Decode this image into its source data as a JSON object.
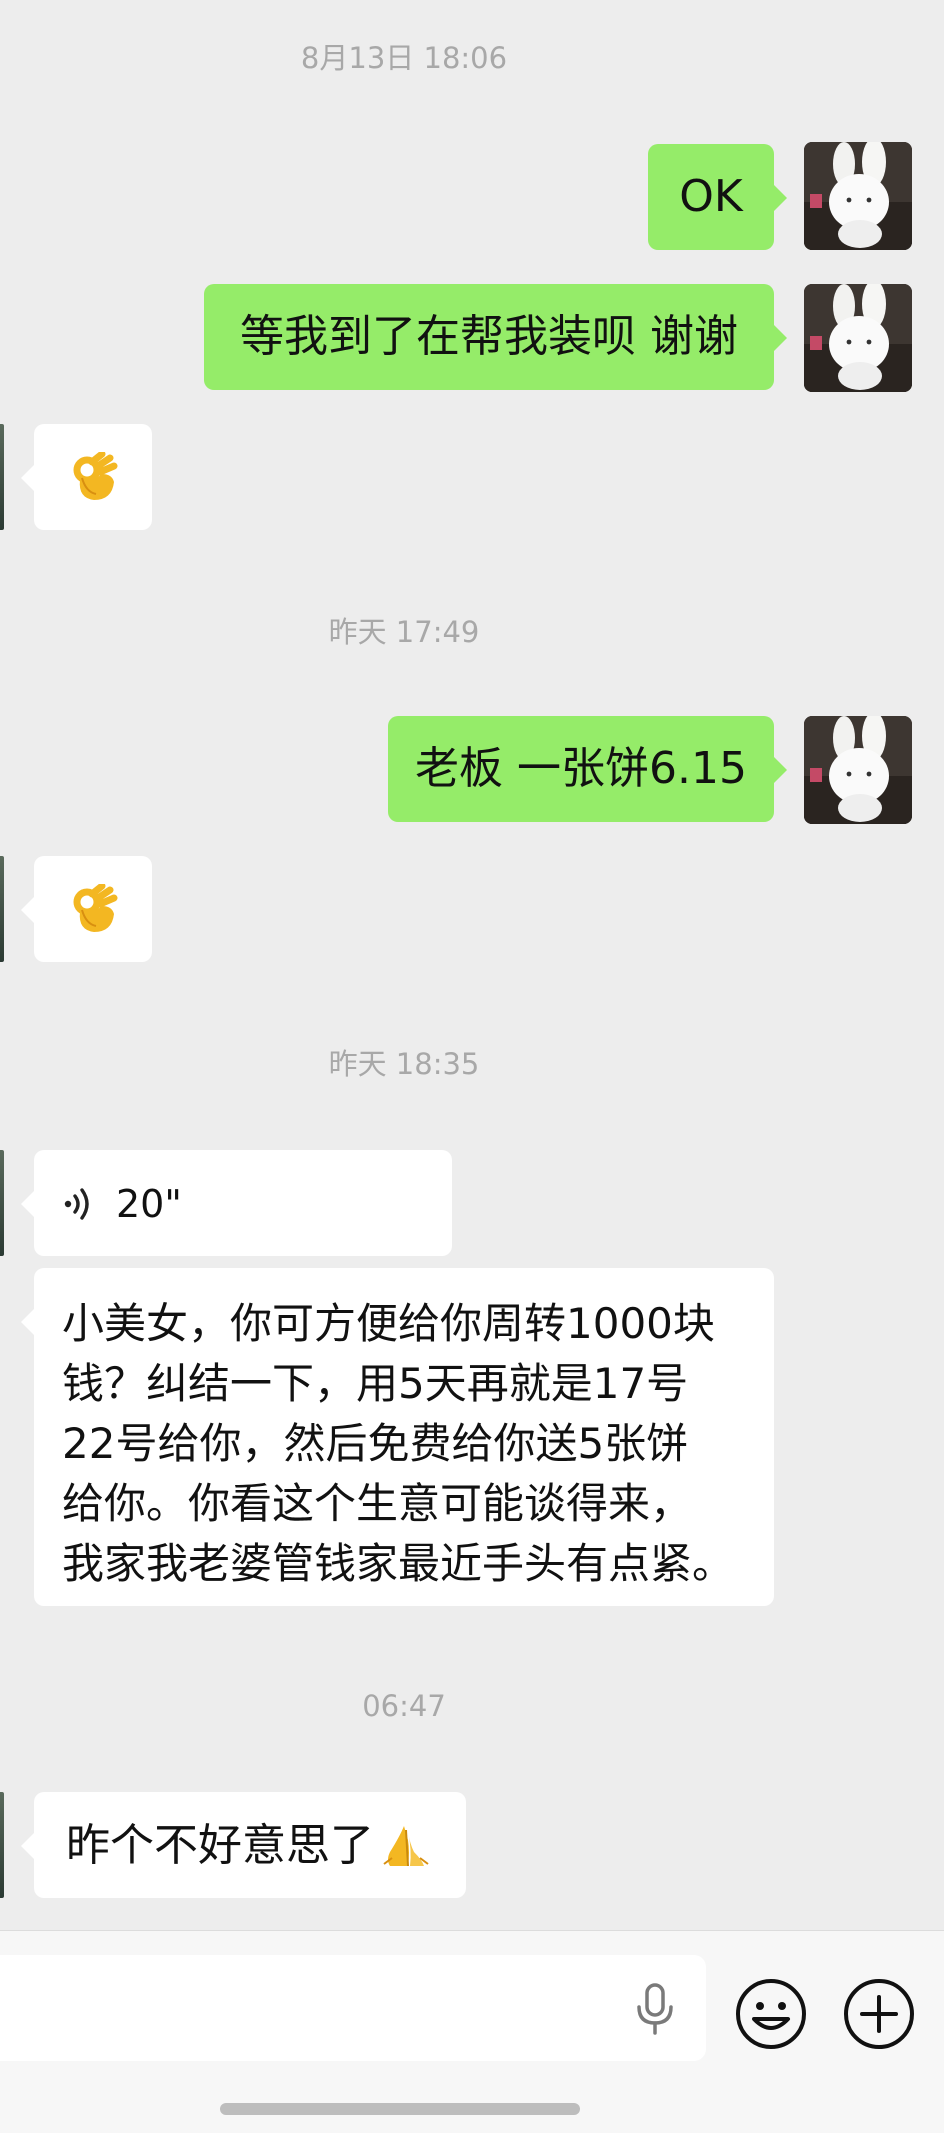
{
  "messages": [
    {
      "type": "timestamp",
      "text": "8月13日 18:06"
    },
    {
      "type": "text",
      "from": "me",
      "text": "OK"
    },
    {
      "type": "text",
      "from": "me",
      "text": "等我到了在帮我装呗 谢谢"
    },
    {
      "type": "emoji",
      "from": "them",
      "icon": "ok-hand-emoji"
    },
    {
      "type": "timestamp",
      "text": "昨天 17:49"
    },
    {
      "type": "text",
      "from": "me",
      "text": "老板 一张饼6.15"
    },
    {
      "type": "emoji",
      "from": "them",
      "icon": "ok-hand-emoji"
    },
    {
      "type": "timestamp",
      "text": "昨天 18:35"
    },
    {
      "type": "voice",
      "from": "them",
      "duration": "20\""
    },
    {
      "type": "text",
      "from": "them",
      "lines": [
        "小美女，你可方便给你周转1000块",
        "钱？纠结一下，用5天再就是17号",
        "22号给你，然后免费给你送5张饼",
        "给你。你看这个生意可能谈得来，",
        "我家我老婆管钱家最近手头有点紧。"
      ]
    },
    {
      "type": "timestamp",
      "text": "06:47"
    },
    {
      "type": "text",
      "from": "them",
      "text": "昨个不好意思了",
      "trailing_icon": "pray-hands-emoji"
    }
  ],
  "colors": {
    "background": "#ededed",
    "my_bubble": "#95ec69",
    "their_bubble": "#ffffff",
    "timestamp_text": "#a8a8a8"
  },
  "input_bar": {
    "icons": [
      "microphone-icon",
      "emoji-smile-icon",
      "plus-circle-icon"
    ]
  }
}
